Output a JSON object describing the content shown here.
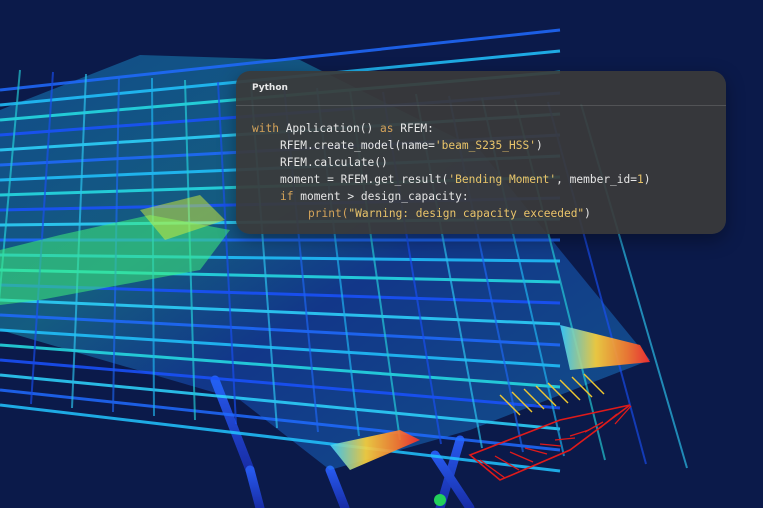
{
  "scene": {
    "background": "#0b1a4a",
    "legend_colors": [
      "#1a3cff",
      "#1fa0ff",
      "#25e0e0",
      "#3ef07a",
      "#d6f23a",
      "#ffd43a",
      "#ff3a2a"
    ]
  },
  "code_panel": {
    "language": "Python",
    "lines": [
      {
        "parts": [
          {
            "t": "with",
            "c": "kw"
          },
          {
            "t": " Application() "
          },
          {
            "t": "as",
            "c": "kw"
          },
          {
            "t": " RFEM:"
          }
        ]
      },
      {
        "parts": [
          {
            "t": "RFEM.create_model(name="
          },
          {
            "t": "'beam_S235_HSS'",
            "c": "str"
          },
          {
            "t": ")"
          }
        ]
      },
      {
        "parts": [
          {
            "t": "RFEM.calculate()"
          }
        ]
      },
      {
        "parts": [
          {
            "t": "moment = RFEM.get_result("
          },
          {
            "t": "'Bending Moment'",
            "c": "str"
          },
          {
            "t": ", member_id="
          },
          {
            "t": "1",
            "c": "num"
          },
          {
            "t": ")"
          }
        ]
      },
      {
        "parts": [
          {
            "t": "if",
            "c": "kw"
          },
          {
            "t": " moment > design_capacity:"
          }
        ]
      },
      {
        "parts": [
          {
            "t": "print(",
            "c": "kw"
          },
          {
            "t": "\"Warning: design capacity exceeded\"",
            "c": "str"
          },
          {
            "t": ")"
          }
        ]
      }
    ]
  }
}
